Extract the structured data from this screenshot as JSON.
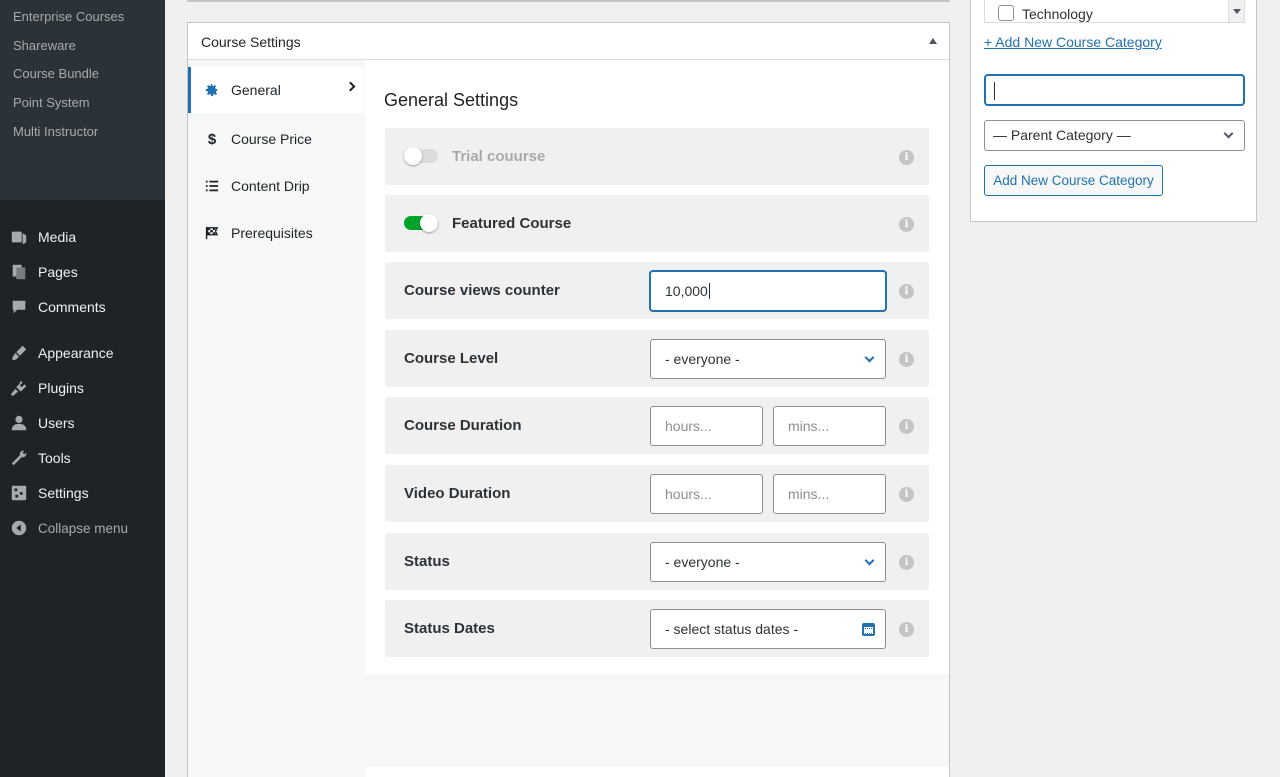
{
  "sidebar": {
    "submenu": [
      "Enterprise Courses",
      "Shareware",
      "Course Bundle",
      "Point System",
      "Multi Instructor"
    ],
    "menu": [
      {
        "label": "Media",
        "icon": "media-icon"
      },
      {
        "label": "Pages",
        "icon": "pages-icon"
      },
      {
        "label": "Comments",
        "icon": "comments-icon"
      },
      {
        "label": "Appearance",
        "icon": "appearance-icon"
      },
      {
        "label": "Plugins",
        "icon": "plugins-icon"
      },
      {
        "label": "Users",
        "icon": "users-icon"
      },
      {
        "label": "Tools",
        "icon": "tools-icon"
      },
      {
        "label": "Settings",
        "icon": "settings-icon"
      }
    ],
    "collapse_label": "Collapse menu"
  },
  "course_settings": {
    "title": "Course Settings",
    "tabs": [
      {
        "label": "General",
        "icon": "gear-icon",
        "active": true
      },
      {
        "label": "Course Price",
        "icon": "dollar-icon",
        "active": false
      },
      {
        "label": "Content Drip",
        "icon": "list-icon",
        "active": false
      },
      {
        "label": "Prerequisites",
        "icon": "checkered-flag-icon",
        "active": false
      }
    ],
    "section_title": "General Settings",
    "trial": {
      "label": "Trial couurse",
      "enabled": false
    },
    "featured": {
      "label": "Featured Course",
      "enabled": true
    },
    "views_counter": {
      "label": "Course views counter",
      "value": "10,000"
    },
    "level": {
      "label": "Course Level",
      "value": "- everyone -"
    },
    "course_duration": {
      "label": "Course Duration",
      "hours_placeholder": "hours...",
      "mins_placeholder": "mins..."
    },
    "video_duration": {
      "label": "Video Duration",
      "hours_placeholder": "hours...",
      "mins_placeholder": "mins..."
    },
    "status": {
      "label": "Status",
      "value": "- everyone -"
    },
    "status_dates": {
      "label": "Status Dates",
      "value": "- select status dates -"
    },
    "info_glyph": "i"
  },
  "categories": {
    "visible_category": "Technology",
    "add_link": "+ Add New Course Category",
    "new_category_value": "",
    "parent_select": "— Parent Category —",
    "add_button": "Add New Course Category"
  },
  "colors": {
    "accent": "#2271b1",
    "toggle_on": "#00a32a",
    "sidebar_bg": "#1d2327"
  }
}
